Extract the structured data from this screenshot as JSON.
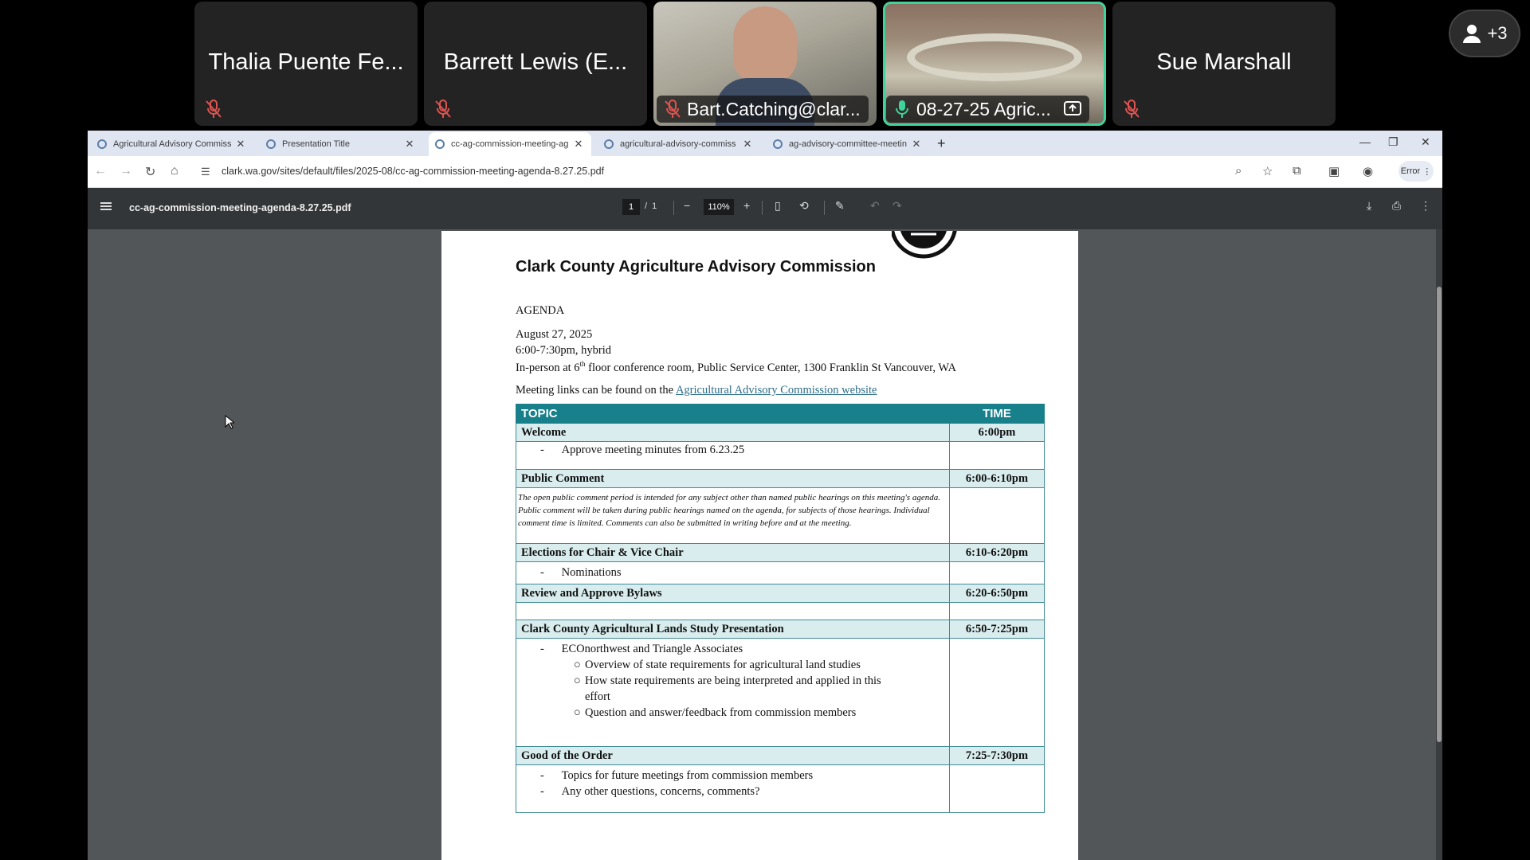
{
  "meeting": {
    "participants": [
      {
        "name": "Thalia Puente Fe...",
        "muted": true
      },
      {
        "name": "Barrett Lewis (E...",
        "muted": true
      },
      {
        "name": "Bart.Catching@clar...",
        "muted": true
      },
      {
        "name": "08-27-25 Agric...",
        "muted": false
      },
      {
        "name": "Sue Marshall",
        "muted": true
      }
    ],
    "more_count": "+3"
  },
  "browser": {
    "tabs": [
      {
        "title": "Agricultural Advisory Commiss"
      },
      {
        "title": "Presentation Title"
      },
      {
        "title": "cc-ag-commission-meeting-ag"
      },
      {
        "title": "agricultural-advisory-commiss"
      },
      {
        "title": "ag-advisory-committee-meetin"
      }
    ],
    "url": "clark.wa.gov/sites/default/files/2025-08/cc-ag-commission-meeting-agenda-8.27.25.pdf",
    "error_label": "Error"
  },
  "pdf": {
    "filename": "cc-ag-commission-meeting-agenda-8.27.25.pdf",
    "page_current": "1",
    "page_total": "1",
    "zoom": "110%"
  },
  "doc": {
    "title": "Clark County Agriculture Advisory Commission",
    "agenda": "AGENDA",
    "date": "August 27, 2025",
    "time": "6:00-7:30pm, hybrid",
    "loc_pre": "In-person at 6",
    "loc_sup": "th",
    "loc_post": " floor conference room, Public Service Center, 1300 Franklin St Vancouver, WA",
    "links_pre": "Meeting links can be found on the ",
    "links_link": "Agricultural Advisory Commission website",
    "col_topic": "TOPIC",
    "col_time": "TIME",
    "sections": [
      {
        "topic": "Welcome",
        "time": "6:00pm",
        "items": [
          "Approve meeting minutes from 6.23.25"
        ]
      },
      {
        "topic": "Public Comment",
        "time": "6:00-6:10pm",
        "note": "The open public comment period is intended for any subject other than named public hearings on this meeting's agenda. Public comment will be taken during public hearings named on the agenda, for subjects of those hearings. Individual comment time is limited. Comments can also be submitted in writing before and at the meeting."
      },
      {
        "topic": "Elections for Chair & Vice Chair",
        "time": "6:10-6:20pm",
        "items": [
          "Nominations"
        ]
      },
      {
        "topic": "Review and Approve Bylaws",
        "time": "6:20-6:50pm"
      },
      {
        "topic": "Clark County Agricultural Lands Study Presentation",
        "time": "6:50-7:25pm",
        "items": [
          "ECOnorthwest and Triangle Associates"
        ],
        "subitems": [
          "Overview of state requirements for agricultural land studies",
          "How state requirements are being interpreted and applied in this",
          "effort",
          "Question and answer/feedback from commission members"
        ]
      },
      {
        "topic": "Good of the Order",
        "time": "7:25-7:30pm",
        "items": [
          "Topics for future meetings from commission members",
          "Any other questions, concerns, comments?"
        ]
      }
    ]
  }
}
